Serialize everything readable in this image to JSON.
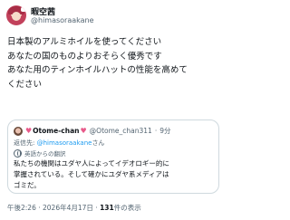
{
  "author": {
    "display_name": "暇空茜",
    "username": "@himasoraakane"
  },
  "tweet": {
    "lines": [
      "日本製のアルミホイルを使ってください",
      "あなたの国のものよりおそらく優秀です",
      "あなた用のティンホイルハットの性能を高めて",
      "ください"
    ]
  },
  "quote": {
    "display_name": "Otome-chan",
    "username": "@Otome_chan311",
    "separator": "·",
    "time": "9分",
    "reply_prefix": "返信先: ",
    "reply_handle": "@himasoraakane",
    "reply_suffix": "さん",
    "translation_note": "英語からの翻訳",
    "lines": [
      "私たちの機関はユダヤ人によってイデオロギー的に",
      "掌握されている。そして確かにユダヤ系メディアは",
      "ゴミだ。"
    ]
  },
  "footer": {
    "time": "午後2:26",
    "dot1": "·",
    "date": "2026年4月17日",
    "dot2": "·",
    "views": "131",
    "views_label": "件の表示"
  },
  "icons": {
    "heart_color": "#e85a8a",
    "link_color": "#1d9bf0"
  }
}
